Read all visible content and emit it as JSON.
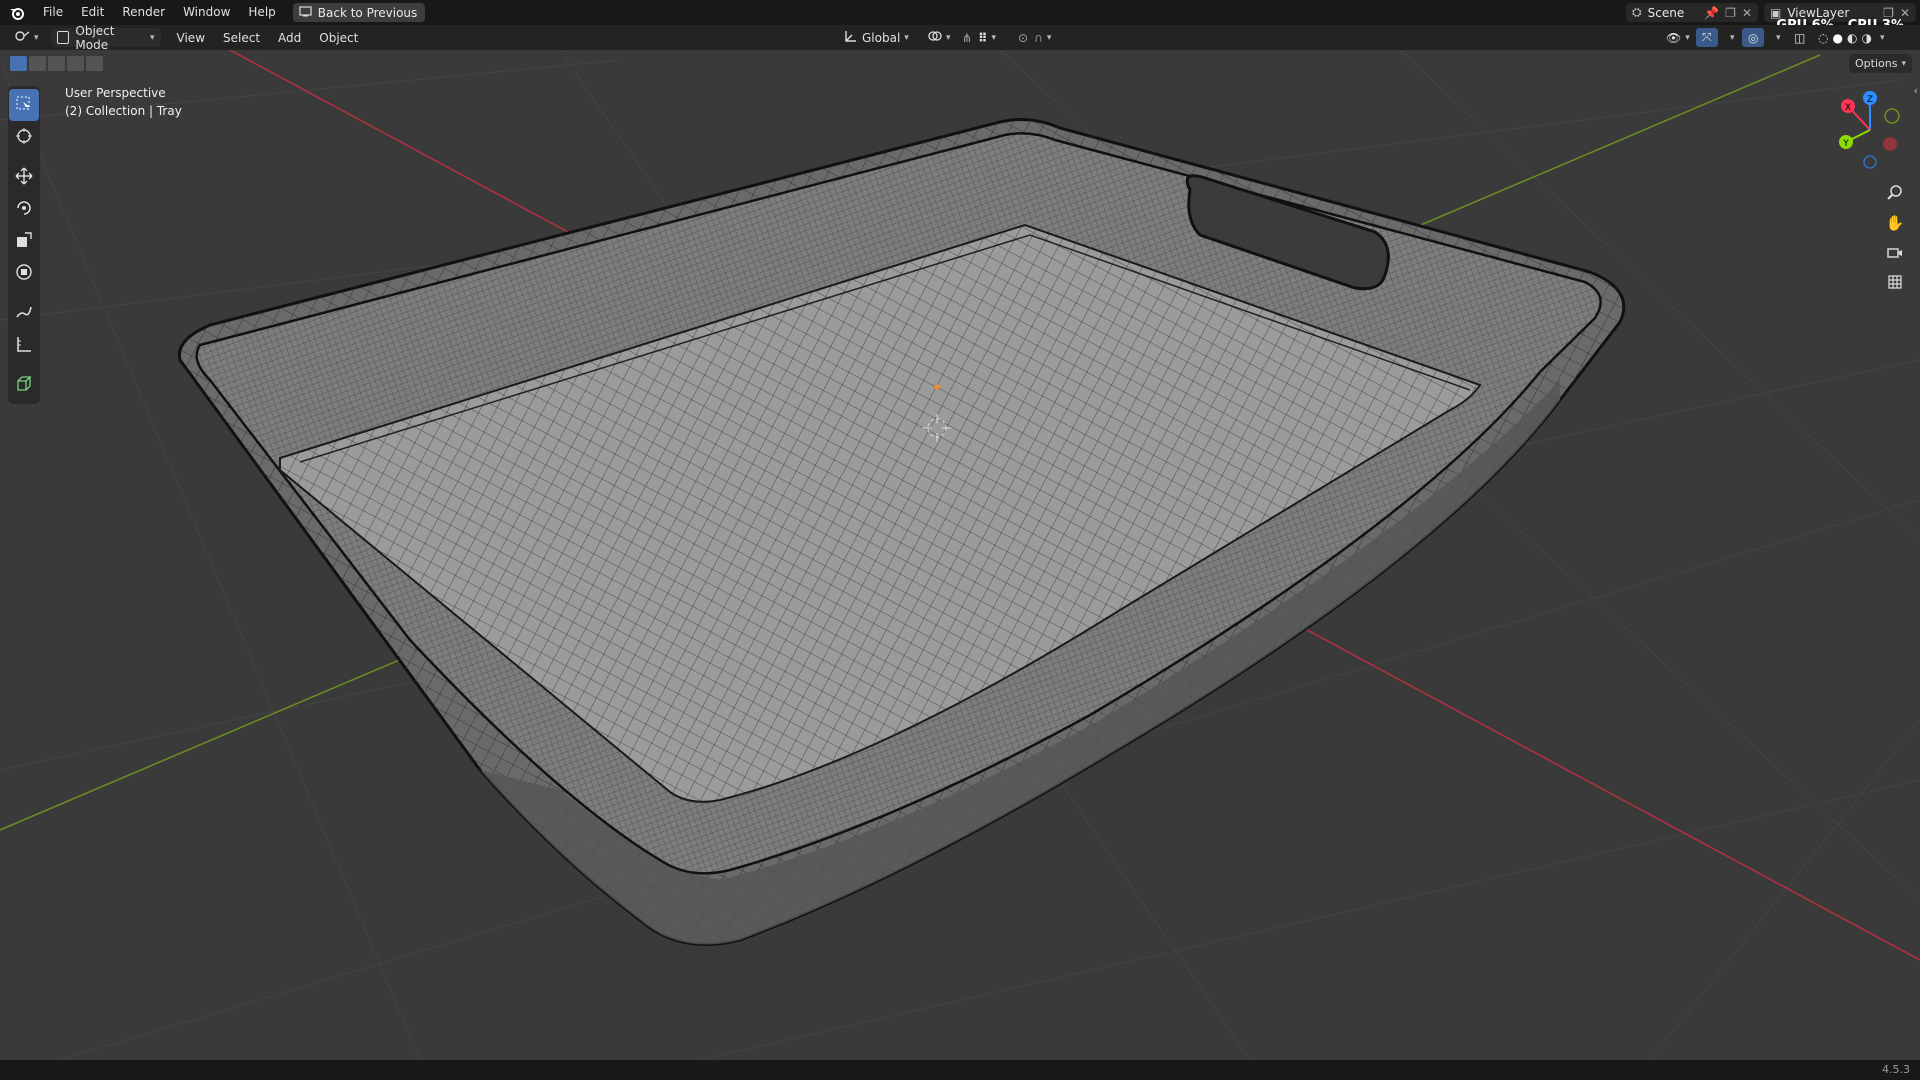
{
  "menu": [
    "File",
    "Edit",
    "Render",
    "Window",
    "Help"
  ],
  "back_button": "Back to Previous",
  "scene": {
    "label": "Scene"
  },
  "view_layer": {
    "label": "ViewLayer"
  },
  "stats": {
    "gpu": "GPU 6%",
    "cpu": "CPU 3%"
  },
  "header": {
    "mode": "Object Mode",
    "menus": [
      "View",
      "Select",
      "Add",
      "Object"
    ],
    "transform_orientation": "Global"
  },
  "viewport": {
    "perspective": "User Perspective",
    "collection_info": "(2) Collection | Tray",
    "options_label": "Options"
  },
  "gizmo": {
    "x": "X",
    "y": "Y",
    "z": "Z"
  },
  "colors": {
    "x_axis": "#ff3352",
    "y_axis": "#8bdc00",
    "z_axis": "#2c8fff",
    "active_tool": "#4772b3",
    "viewport_bg": "#3a3a3a",
    "mesh_fill": "#9b9b9b",
    "wire": "#1a1a1a"
  },
  "tools": [
    "select-box-icon",
    "cursor-icon",
    "move-icon",
    "rotate-icon",
    "scale-icon",
    "transform-icon",
    "annotate-icon",
    "measure-icon",
    "add-cube-icon"
  ],
  "version": "4.5.3"
}
